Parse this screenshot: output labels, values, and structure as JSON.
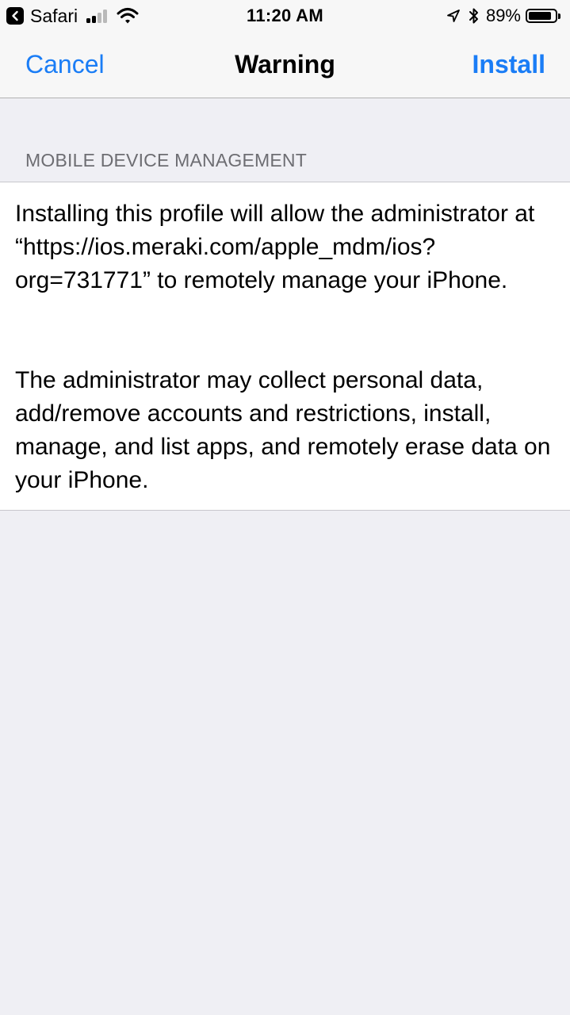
{
  "status_bar": {
    "back_app_label": "Safari",
    "time": "11:20 AM",
    "battery_percent": "89%",
    "battery_level": 0.89,
    "signal_bars_filled": 2,
    "signal_bars_total": 4
  },
  "nav": {
    "cancel_label": "Cancel",
    "title": "Warning",
    "install_label": "Install"
  },
  "section": {
    "header": "MOBILE DEVICE MANAGEMENT",
    "paragraph_1": "Installing this profile will allow the administrator at “https://ios.meraki.com/apple_mdm/ios?org=731771” to remotely manage your iPhone.",
    "paragraph_2": "The administrator may collect personal data, add/remove accounts and restrictions, install, manage, and list apps, and remotely erase data on your iPhone."
  },
  "colors": {
    "accent": "#1a7df6",
    "background": "#efeff4",
    "section_header_text": "#6d6d72"
  },
  "icons": [
    "back-to-app-icon",
    "signal-icon",
    "wifi-icon",
    "location-icon",
    "bluetooth-icon",
    "battery-icon"
  ]
}
